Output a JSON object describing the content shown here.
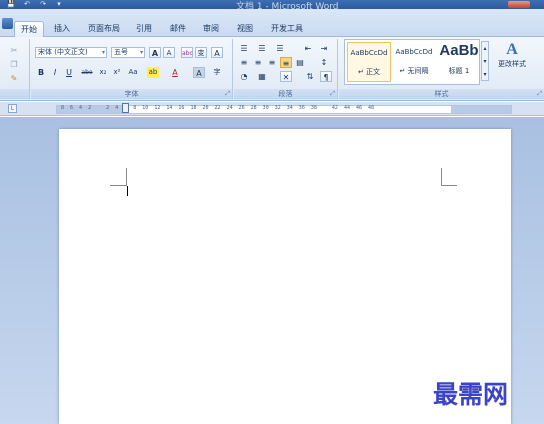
{
  "window": {
    "title": "文档 1 - Microsoft Word",
    "quick_access": [
      "💾",
      "↶",
      "↷",
      "▾"
    ]
  },
  "tabs": [
    {
      "label": "开始",
      "active": true
    },
    {
      "label": "插入",
      "active": false
    },
    {
      "label": "页面布局",
      "active": false
    },
    {
      "label": "引用",
      "active": false
    },
    {
      "label": "邮件",
      "active": false
    },
    {
      "label": "审阅",
      "active": false
    },
    {
      "label": "视图",
      "active": false
    },
    {
      "label": "开发工具",
      "active": false
    }
  ],
  "ribbon": {
    "clipboard": {
      "label": ""
    },
    "font": {
      "label": "字体",
      "font_name": "宋体 (中文正文)",
      "font_size": "五号",
      "buttons_row1": [
        "A",
        "A",
        "abc",
        "变",
        "A"
      ],
      "buttons_row2": [
        "B",
        "I",
        "U",
        "abe",
        "x₂",
        "x²",
        "Aa",
        "ab",
        "A",
        "A",
        "字"
      ]
    },
    "paragraph": {
      "label": "段落"
    },
    "styles": {
      "label": "样式",
      "items": [
        {
          "sample": "AaBbCcDd",
          "name": "↵ 正文",
          "selected": true
        },
        {
          "sample": "AaBbCcDd",
          "name": "↵ 无间隔",
          "selected": false
        },
        {
          "sample": "AaBb",
          "name": "标题 1",
          "selected": false
        }
      ],
      "change_styles": "更改样式"
    }
  },
  "ruler": {
    "numbers": "8  6  4  2     2  4  6  8  10  12  14  16  18  20  22  24  26  28  30  32  34  36  38     42  44  46  48",
    "tab_selector": "L"
  },
  "watermark": "最需网"
}
